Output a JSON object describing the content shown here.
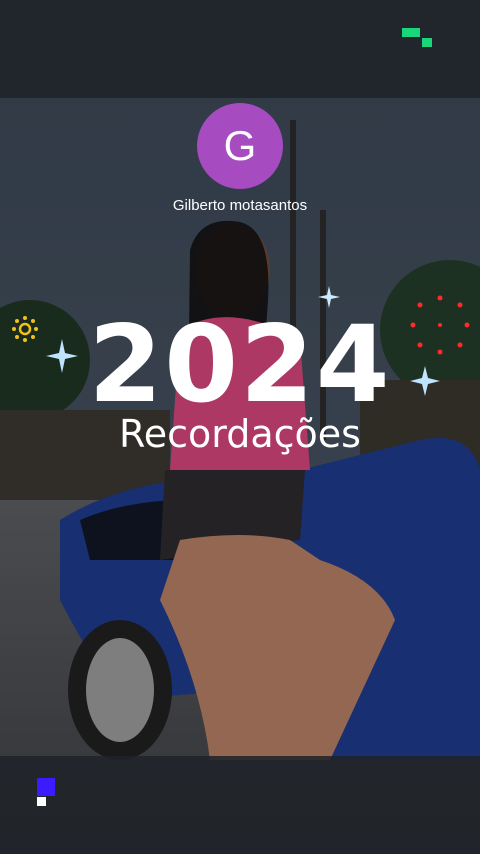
{
  "profile": {
    "avatar_letter": "G",
    "username": "Gilberto motasantos"
  },
  "story": {
    "year": "2024",
    "subtitle": "Recordações"
  },
  "colors": {
    "avatar": "#a64bc0",
    "top_logo": "#19d67a",
    "bottom_logo": "#3c1cff"
  }
}
